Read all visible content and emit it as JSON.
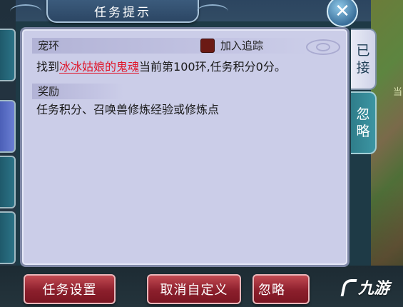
{
  "window": {
    "title": "任务提示"
  },
  "quest": {
    "section_title": "宠环",
    "track_label": "加入追踪",
    "description_prefix": "找到",
    "target_name": "冰冰姑娘的鬼魂",
    "description_suffix": "当前第100环,任务积分0分。"
  },
  "reward": {
    "section_title": "奖励",
    "text": "任务积分、召唤兽修炼经验或修炼点"
  },
  "side_tabs": {
    "accepted": [
      "已",
      "接"
    ],
    "ignored": [
      "忽",
      "略"
    ]
  },
  "buttons": {
    "settings": "任务设置",
    "custom": "取消自定义",
    "ignore": "忽略"
  },
  "background": {
    "right_text": "当"
  },
  "watermark": {
    "text": "九游"
  },
  "colors": {
    "target_link": "#e0162a",
    "panel": "#cbcde8",
    "button": "#8c1f2c"
  }
}
